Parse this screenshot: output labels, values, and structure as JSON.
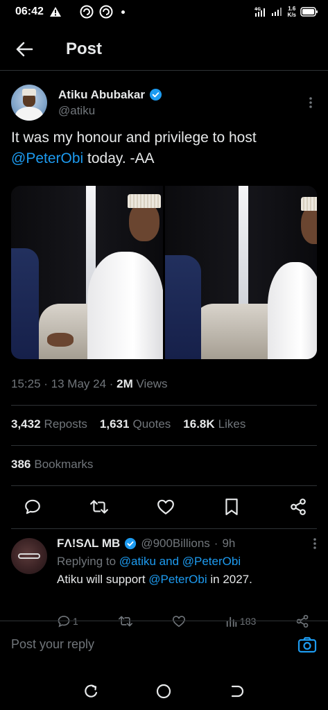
{
  "status_bar": {
    "time": "06:42",
    "net_speed_value": "1.6",
    "net_speed_unit": "K/s",
    "icons": [
      "warning-icon",
      "app-icon",
      "app-icon",
      "notification-dot",
      "4g-signal-icon",
      "signal-icon",
      "battery-icon"
    ]
  },
  "header": {
    "title": "Post"
  },
  "tweet": {
    "author_name": "Atiku Abubakar",
    "author_handle": "@atiku",
    "text_part1": "It was my honour and privilege to host",
    "mention": "@PeterObi",
    "text_part2": " today. -AA",
    "time": "15:25",
    "date": "13 May 24",
    "views_count": "2M",
    "views_label": "Views",
    "reposts_count": "3,432",
    "reposts_label": "Reposts",
    "quotes_count": "1,631",
    "quotes_label": "Quotes",
    "likes_count": "16.8K",
    "likes_label": "Likes",
    "bookmarks_count": "386",
    "bookmarks_label": "Bookmarks"
  },
  "reply": {
    "author_name": "FΛ!SΛL MB",
    "author_handle": "@900Billions",
    "age": "9h",
    "replying_label": "Replying to ",
    "replying_to": "@atiku and @PeterObi",
    "text_part1": "Atiku will support ",
    "mention": "@PeterObi",
    "text_part2": " in 2027.",
    "reply_count": "1",
    "views_count": "183"
  },
  "compose": {
    "placeholder": "Post your reply"
  },
  "colors": {
    "accent": "#1d9bf0",
    "background": "#000000",
    "muted": "#71767b",
    "text": "#e7e9ea",
    "divider": "#2f3336"
  }
}
